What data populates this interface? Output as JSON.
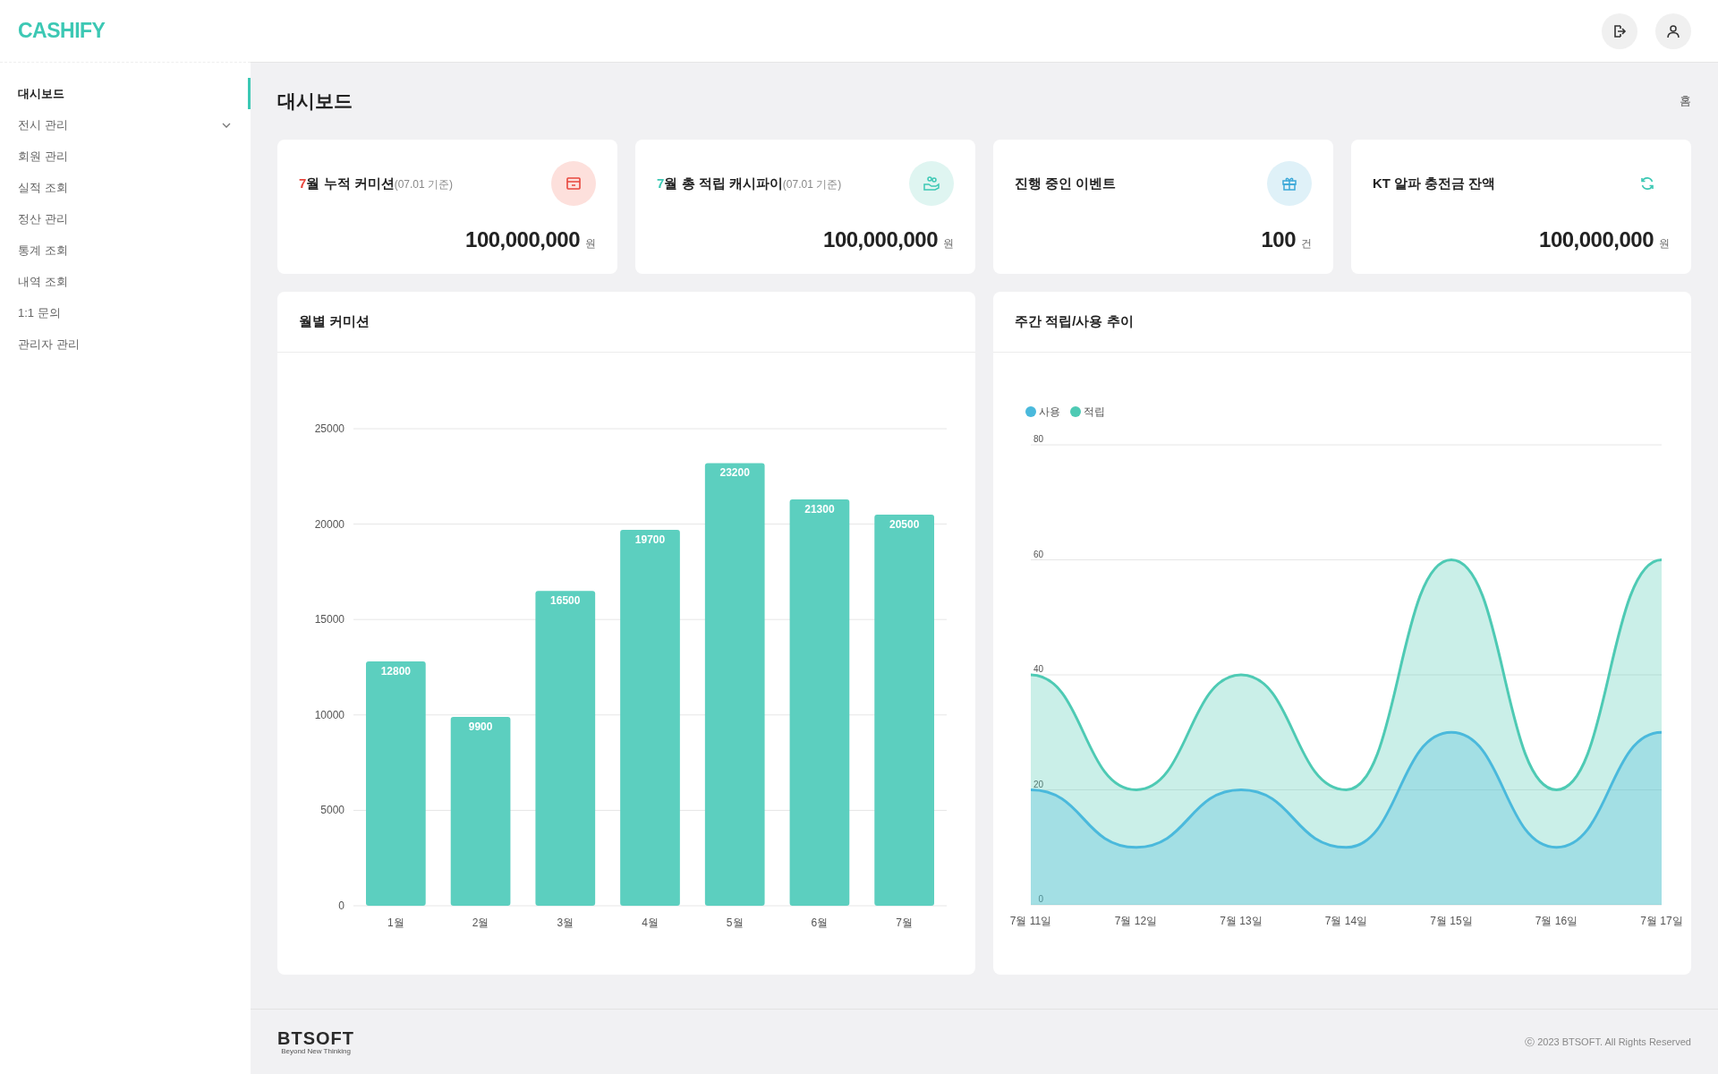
{
  "sidebar": {
    "logo": "CASHIFY",
    "items": [
      {
        "label": "대시보드",
        "selected": true,
        "kind": "link"
      },
      {
        "label": "전시 관리",
        "selected": false,
        "kind": "group"
      },
      {
        "label": "회원 관리",
        "selected": false,
        "kind": "link"
      },
      {
        "label": "실적 조회",
        "selected": false,
        "kind": "link"
      },
      {
        "label": "정산 관리",
        "selected": false,
        "kind": "link"
      },
      {
        "label": "통계 조회",
        "selected": false,
        "kind": "link"
      },
      {
        "label": "내역 조회",
        "selected": false,
        "kind": "link"
      },
      {
        "label": "1:1 문의",
        "selected": false,
        "kind": "link"
      },
      {
        "label": "관리자 관리",
        "selected": false,
        "kind": "link"
      }
    ]
  },
  "page": {
    "title": "대시보드",
    "breadcrumb": "홈"
  },
  "cards": [
    {
      "kind": "commission",
      "accent": "7",
      "title": "월 누적 커미션",
      "note": "(07.01 기준)",
      "value": "100,000,000",
      "unit": "원"
    },
    {
      "kind": "cashback",
      "accent": "7",
      "title": "월 총 적립 캐시파이",
      "note": "(07.01 기준)",
      "value": "100,000,000",
      "unit": "원"
    },
    {
      "kind": "event",
      "title": "진행 중인 이벤트",
      "value": "100",
      "unit": "건"
    },
    {
      "kind": "balance",
      "title": "KT 알파 충전금 잔액",
      "value": "100,000,000",
      "unit": "원"
    }
  ],
  "charts": [
    {
      "title": "월별 커미션",
      "chart_data": {
        "type": "bar",
        "categories": [
          "1월",
          "2월",
          "3월",
          "4월",
          "5월",
          "6월",
          "7월"
        ],
        "series": [
          {
            "color": "#5ccfbf",
            "values": [
              12800,
              9900,
              16500,
              19700,
              23200,
              21300,
              20500
            ]
          }
        ],
        "ylim": [
          0,
          25000
        ],
        "yticks": [
          0,
          5000,
          10000,
          15000,
          20000,
          25000
        ],
        "grid": true,
        "data_labels": true
      }
    },
    {
      "title": "주간 적립/사용 추이",
      "chart_data": {
        "type": "area",
        "categories": [
          "7월 11일",
          "7월 12일",
          "7월 13일",
          "7월 14일",
          "7월 15일",
          "7월 16일",
          "7월 17일"
        ],
        "series": [
          {
            "name": "사용",
            "color": "#4ab9dc",
            "values": [
              20,
              10,
              20,
              10,
              30,
              10,
              30
            ]
          },
          {
            "name": "적립",
            "color": "#4ecab4",
            "values": [
              40,
              20,
              40,
              20,
              60,
              20,
              60
            ]
          }
        ],
        "ylim": [
          0,
          80
        ],
        "yticks": [
          0,
          20,
          40,
          60,
          80
        ],
        "grid": true,
        "legend": "top-left"
      }
    }
  ],
  "footer": {
    "logo": "BTSOFT",
    "tagline": "Beyond New Thinking",
    "copyright": "ⓒ 2023 BTSOFT. All Rights Reserved"
  }
}
